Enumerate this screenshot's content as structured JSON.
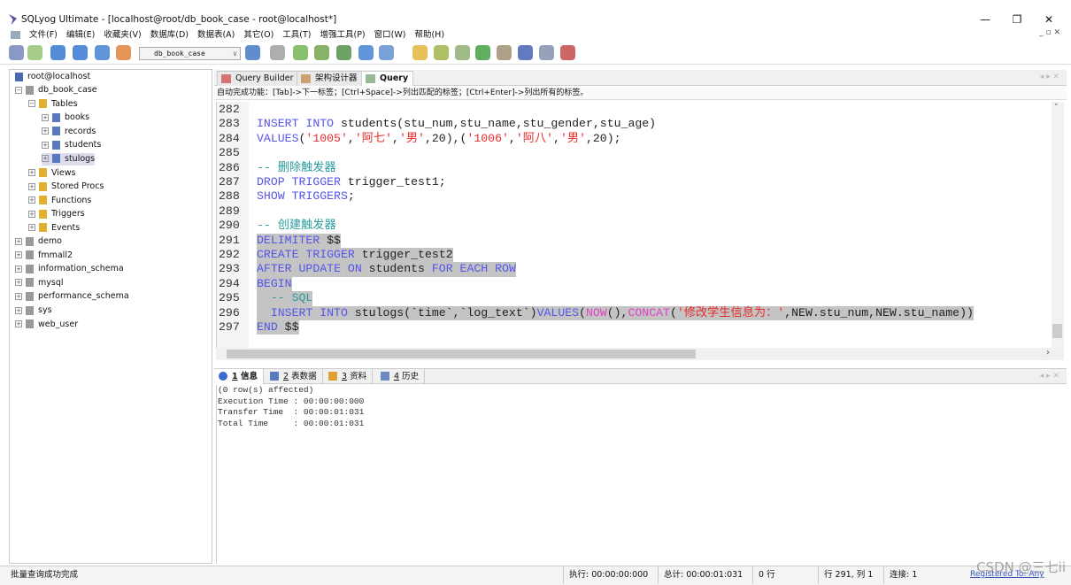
{
  "window": {
    "title": "SQLyog Ultimate - [localhost@root/db_book_case - root@localhost*]",
    "minimize": "—",
    "maximize": "❐",
    "close": "✕"
  },
  "menu": [
    "文件(F)",
    "编辑(E)",
    "收藏夹(V)",
    "数据库(D)",
    "数据表(A)",
    "其它(O)",
    "工具(T)",
    "增强工具(P)",
    "窗口(W)",
    "帮助(H)"
  ],
  "mdi_controls": "_ ▫ ✕",
  "toolbar": {
    "database_select": "db_book_case",
    "colors": [
      "#6b7fb5",
      "#8fbf6a",
      "#2a6fd0",
      "#2a6fd0",
      "#3a7ad0",
      "#e07a30",
      "#3a70c0",
      "#9a9a9a",
      "#6ab04a",
      "#6aa040",
      "#4a8a40",
      "#3a7ad0",
      "#5a8ad0",
      "#e0b030",
      "#9ab040",
      "#8aaa6a",
      "#3a9a3a",
      "#9a8a6a",
      "#3a5ab0",
      "#7a8aaa",
      "#c04040",
      "#d07030"
    ]
  },
  "tree": {
    "root": "root@localhost",
    "nodes": [
      {
        "label": "db_book_case",
        "level": 1,
        "pm": "⊟",
        "icon": "database"
      },
      {
        "label": "Tables",
        "level": 2,
        "pm": "⊟",
        "icon": "folder"
      },
      {
        "label": "books",
        "level": 3,
        "pm": "⊞",
        "icon": "table"
      },
      {
        "label": "records",
        "level": 3,
        "pm": "⊞",
        "icon": "table"
      },
      {
        "label": "students",
        "level": 3,
        "pm": "⊞",
        "icon": "table"
      },
      {
        "label": "stulogs",
        "level": 3,
        "pm": "⊞",
        "icon": "table",
        "selected": true
      },
      {
        "label": "Views",
        "level": 2,
        "pm": "⊞",
        "icon": "folder"
      },
      {
        "label": "Stored Procs",
        "level": 2,
        "pm": "⊞",
        "icon": "folder"
      },
      {
        "label": "Functions",
        "level": 2,
        "pm": "⊞",
        "icon": "folder"
      },
      {
        "label": "Triggers",
        "level": 2,
        "pm": "⊞",
        "icon": "folder"
      },
      {
        "label": "Events",
        "level": 2,
        "pm": "⊞",
        "icon": "folder"
      },
      {
        "label": "demo",
        "level": 1,
        "pm": "⊞",
        "icon": "database"
      },
      {
        "label": "fmmall2",
        "level": 1,
        "pm": "⊞",
        "icon": "database"
      },
      {
        "label": "information_schema",
        "level": 1,
        "pm": "⊞",
        "icon": "database"
      },
      {
        "label": "mysql",
        "level": 1,
        "pm": "⊞",
        "icon": "database"
      },
      {
        "label": "performance_schema",
        "level": 1,
        "pm": "⊞",
        "icon": "database"
      },
      {
        "label": "sys",
        "level": 1,
        "pm": "⊞",
        "icon": "database"
      },
      {
        "label": "web_user",
        "level": 1,
        "pm": "⊞",
        "icon": "database"
      }
    ]
  },
  "editor_tabs": [
    {
      "label": "Query Builder"
    },
    {
      "label": "架构设计器"
    },
    {
      "label": "Query",
      "active": true
    }
  ],
  "hint": "自动完成功能：[Tab]->下一标签；[Ctrl+Space]->列出匹配的标签；[Ctrl+Enter]->列出所有的标签。",
  "code": [
    {
      "n": "282",
      "t": []
    },
    {
      "n": "283",
      "t": [
        [
          "k",
          "INSERT"
        ],
        [
          "p",
          " "
        ],
        [
          "k",
          "INTO"
        ],
        [
          "p",
          " students(stu_num,stu_name,stu_gender,stu_age)"
        ]
      ]
    },
    {
      "n": "284",
      "t": [
        [
          "k",
          "VALUES"
        ],
        [
          "p",
          "("
        ],
        [
          "s",
          "'1005'"
        ],
        [
          "p",
          ","
        ],
        [
          "s",
          "'阿七'"
        ],
        [
          "p",
          ","
        ],
        [
          "s",
          "'男'"
        ],
        [
          "p",
          ",20),("
        ],
        [
          "s",
          "'1006'"
        ],
        [
          "p",
          ","
        ],
        [
          "s",
          "'阿八'"
        ],
        [
          "p",
          ","
        ],
        [
          "s",
          "'男'"
        ],
        [
          "p",
          ",20);"
        ]
      ]
    },
    {
      "n": "285",
      "t": []
    },
    {
      "n": "286",
      "t": [
        [
          "c",
          "-- 删除触发器"
        ]
      ]
    },
    {
      "n": "287",
      "t": [
        [
          "k",
          "DROP"
        ],
        [
          "p",
          " "
        ],
        [
          "k",
          "TRIGGER"
        ],
        [
          "p",
          " trigger_test1;"
        ]
      ]
    },
    {
      "n": "288",
      "t": [
        [
          "k",
          "SHOW"
        ],
        [
          "p",
          " "
        ],
        [
          "k",
          "TRIGGERS"
        ],
        [
          "p",
          ";"
        ]
      ]
    },
    {
      "n": "289",
      "t": []
    },
    {
      "n": "290",
      "t": [
        [
          "c",
          "-- 创建触发器"
        ]
      ]
    },
    {
      "n": "291",
      "sel": true,
      "t": [
        [
          "k",
          "DELIMITER"
        ],
        [
          "p",
          " $$"
        ]
      ]
    },
    {
      "n": "292",
      "sel": true,
      "t": [
        [
          "k",
          "CREATE"
        ],
        [
          "p",
          " "
        ],
        [
          "k",
          "TRIGGER"
        ],
        [
          "p",
          " trigger_test2"
        ]
      ]
    },
    {
      "n": "293",
      "sel": true,
      "t": [
        [
          "k",
          "AFTER"
        ],
        [
          "p",
          " "
        ],
        [
          "k",
          "UPDATE"
        ],
        [
          "p",
          " "
        ],
        [
          "k",
          "ON"
        ],
        [
          "p",
          " students "
        ],
        [
          "k",
          "FOR"
        ],
        [
          "p",
          " "
        ],
        [
          "k",
          "EACH"
        ],
        [
          "p",
          " "
        ],
        [
          "k",
          "ROW"
        ]
      ]
    },
    {
      "n": "294",
      "sel": true,
      "t": [
        [
          "k",
          "BEGIN"
        ]
      ]
    },
    {
      "n": "295",
      "sel": true,
      "t": [
        [
          "p",
          "  "
        ],
        [
          "c",
          "-- SQL"
        ]
      ]
    },
    {
      "n": "296",
      "sel": true,
      "t": [
        [
          "p",
          "  "
        ],
        [
          "k",
          "INSERT"
        ],
        [
          "p",
          " "
        ],
        [
          "k",
          "INTO"
        ],
        [
          "p",
          " stulogs(`time`,`log_text`)"
        ],
        [
          "k",
          "VALUES"
        ],
        [
          "p",
          "("
        ],
        [
          "f",
          "NOW"
        ],
        [
          "p",
          "(),"
        ],
        [
          "f",
          "CONCAT"
        ],
        [
          "p",
          "("
        ],
        [
          "s",
          "'修改学生信息为：'"
        ],
        [
          "p",
          ",NEW.stu_num,NEW.stu_name))"
        ]
      ]
    },
    {
      "n": "297",
      "sel": true,
      "t": [
        [
          "k",
          "END"
        ],
        [
          "p",
          " $$"
        ]
      ]
    }
  ],
  "result_tabs": [
    {
      "num": "1",
      "label": "信息",
      "active": true
    },
    {
      "num": "2",
      "label": "表数据"
    },
    {
      "num": "3",
      "label": "资料"
    },
    {
      "num": "4",
      "label": "历史"
    }
  ],
  "results": [
    "(0 row(s) affected)",
    "Execution Time : 00:00:00:000",
    "Transfer Time  : 00:00:01:031",
    "Total Time     : 00:00:01:031"
  ],
  "status": {
    "message": "批量查询成功完成",
    "exec": "执行: 00:00:00:000",
    "total": "总计: 00:00:01:031",
    "rows": "0 行",
    "position": "行 291, 列 1",
    "connections": "连接: 1",
    "registered": "Registered To: Any"
  },
  "watermark": "CSDN @三七ii"
}
